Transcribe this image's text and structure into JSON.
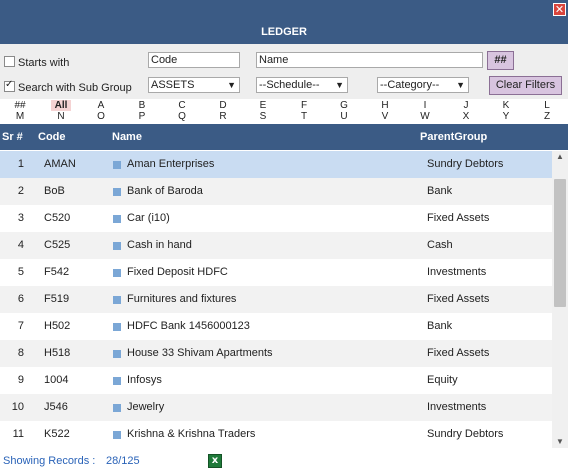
{
  "window": {
    "title": "LEDGER",
    "close_glyph": "✕"
  },
  "filters": {
    "starts_with_label": "Starts with",
    "starts_with_checked": false,
    "subgroup_label": "Search with Sub Group",
    "subgroup_checked": true,
    "code_value": "Code",
    "name_value": "Name",
    "hash_label": "##",
    "group_select": "ASSETS",
    "schedule_select": "--Schedule--",
    "category_select": "--Category--",
    "clear_label": "Clear Filters"
  },
  "alphabet": {
    "row1": [
      "##",
      "All",
      "A",
      "B",
      "C",
      "D",
      "E",
      "F",
      "G",
      "H",
      "I",
      "J",
      "K",
      "L"
    ],
    "row2": [
      "M",
      "N",
      "O",
      "P",
      "Q",
      "R",
      "S",
      "T",
      "U",
      "V",
      "W",
      "X",
      "Y",
      "Z"
    ],
    "selected": "All"
  },
  "grid": {
    "headers": {
      "sr": "Sr #",
      "code": "Code",
      "name": "Name",
      "parent": "ParentGroup"
    },
    "rows": [
      {
        "sr": "1",
        "code": "AMAN",
        "name": "Aman Enterprises",
        "parent": "Sundry Debtors"
      },
      {
        "sr": "2",
        "code": "BoB",
        "name": "Bank of Baroda",
        "parent": "Bank"
      },
      {
        "sr": "3",
        "code": "C520",
        "name": "Car (i10)",
        "parent": "Fixed Assets"
      },
      {
        "sr": "4",
        "code": "C525",
        "name": "Cash in hand",
        "parent": "Cash"
      },
      {
        "sr": "5",
        "code": "F542",
        "name": "Fixed Deposit HDFC",
        "parent": "Investments"
      },
      {
        "sr": "6",
        "code": "F519",
        "name": "Furnitures and fixtures",
        "parent": "Fixed Assets"
      },
      {
        "sr": "7",
        "code": "H502",
        "name": "HDFC Bank 1456000123",
        "parent": "Bank"
      },
      {
        "sr": "8",
        "code": "H518",
        "name": "House 33 Shivam Apartments",
        "parent": "Fixed Assets"
      },
      {
        "sr": "9",
        "code": "1004",
        "name": "Infosys",
        "parent": "Equity"
      },
      {
        "sr": "10",
        "code": "J546",
        "name": "Jewelry",
        "parent": "Investments"
      },
      {
        "sr": "11",
        "code": "K522",
        "name": "Krishna & Krishna Traders",
        "parent": "Sundry Debtors"
      }
    ],
    "selected_row": 0
  },
  "footer": {
    "records_label": "Showing Records :",
    "records_value": "28/125",
    "export_icon": "excel-icon"
  },
  "colors": {
    "header_bg": "#3b5b85",
    "selected_row": "#c9dcf2",
    "button_bg": "#d8c4df",
    "link_blue": "#2a63b8"
  }
}
